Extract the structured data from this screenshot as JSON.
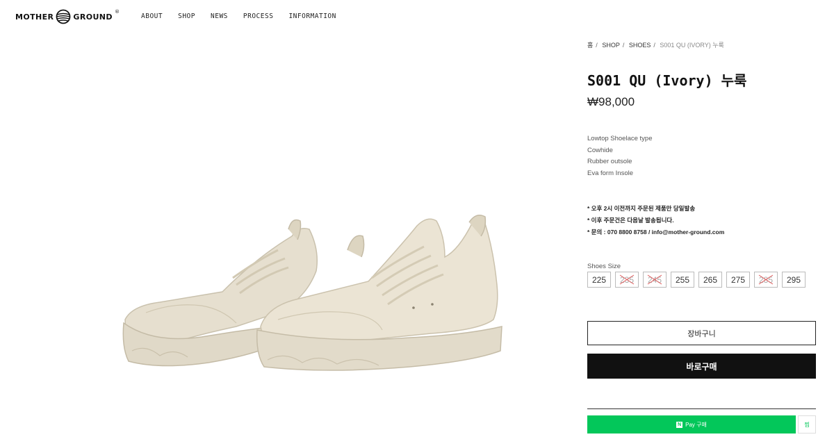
{
  "header": {
    "logo_left": "MOTHER",
    "logo_right": "GROUND",
    "logo_reg": "®",
    "nav": [
      "ABOUT",
      "SHOP",
      "NEWS",
      "PROCESS",
      "INFORMATION"
    ]
  },
  "breadcrumb": {
    "items": [
      "홈",
      "SHOP",
      "SHOES"
    ],
    "separator": "/",
    "current": "S001 QU (IVORY) 누룩"
  },
  "product": {
    "title": "S001 QU (Ivory) 누룩",
    "price": "₩98,000",
    "description": [
      "Lowtop Shoelace type",
      "Cowhide",
      "Rubber outsole",
      "Eva form Insole"
    ],
    "notes": [
      "* 오후 2시 이전까지 주문된 제품만 당일발송",
      "* 이후 주문건은 다음날 발송됩니다.",
      "* 문의 : 070 8800 8758 / info@mother-ground.com"
    ],
    "image_icon": "sneaker-pair-image"
  },
  "sizes": {
    "label": "Shoes Size",
    "options": [
      {
        "value": "225",
        "soldout": false
      },
      {
        "value": "235",
        "soldout": true
      },
      {
        "value": "245",
        "soldout": true
      },
      {
        "value": "255",
        "soldout": false
      },
      {
        "value": "265",
        "soldout": false
      },
      {
        "value": "275",
        "soldout": false
      },
      {
        "value": "285",
        "soldout": true
      },
      {
        "value": "295",
        "soldout": false
      }
    ]
  },
  "actions": {
    "cart_label": "장바구니",
    "buy_label": "바로구매",
    "npay_label": "Pay 구매",
    "npay_logo": "N",
    "npay_side_label": "찜"
  },
  "colors": {
    "buy_bg": "#111111",
    "npay_green": "#03c75a",
    "soldout_cross": "#e05a5a",
    "shoe_color": "#e4ddcc"
  }
}
